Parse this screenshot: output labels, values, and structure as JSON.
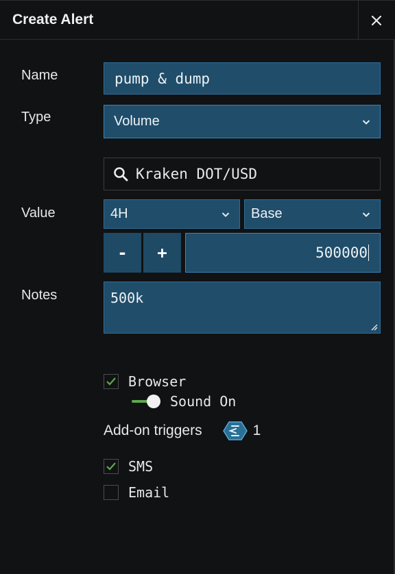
{
  "header": {
    "title": "Create Alert",
    "close_icon": "close-icon"
  },
  "form": {
    "name": {
      "label": "Name",
      "value": "pump & dump"
    },
    "type": {
      "label": "Type",
      "selected": "Volume"
    },
    "symbol_search": {
      "value": "Kraken DOT/USD",
      "icon": "search-icon"
    },
    "value": {
      "label": "Value",
      "interval": "4H",
      "basis": "Base",
      "decrement_label": "-",
      "increment_label": "+",
      "amount": "500000"
    },
    "notes": {
      "label": "Notes",
      "value": "500k"
    }
  },
  "notifications": {
    "browser": {
      "label": "Browser",
      "checked": true
    },
    "sound": {
      "label": "Sound On",
      "on": true
    },
    "addon": {
      "label": "Add-on triggers",
      "count": "1"
    },
    "sms": {
      "label": "SMS",
      "checked": true
    },
    "email": {
      "label": "Email",
      "checked": false
    }
  },
  "colors": {
    "background": "#111214",
    "field": "#1f4d6a",
    "field_border": "#3b84b8",
    "check": "#5fa84e",
    "badge": "#2a6f95"
  }
}
